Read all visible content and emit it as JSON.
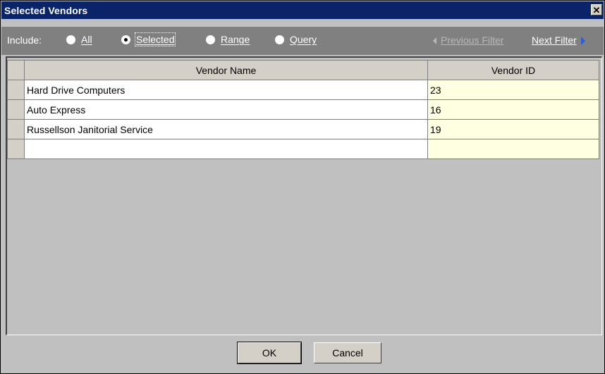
{
  "window": {
    "title": "Selected Vendors",
    "close_glyph": "✕"
  },
  "filter": {
    "include_label": "Include:",
    "options": [
      {
        "label": "All",
        "checked": false
      },
      {
        "label": "Selected",
        "checked": true
      },
      {
        "label": "Range",
        "checked": false
      },
      {
        "label": "Query",
        "checked": false
      }
    ],
    "previous_filter": "Previous Filter",
    "next_filter": "Next Filter"
  },
  "grid": {
    "columns": [
      "Vendor Name",
      "Vendor ID"
    ],
    "rows": [
      {
        "name": "Hard Drive Computers",
        "id": "23"
      },
      {
        "name": "Auto Express",
        "id": "16"
      },
      {
        "name": "Russellson Janitorial Service",
        "id": "19"
      },
      {
        "name": "",
        "id": ""
      }
    ]
  },
  "buttons": {
    "ok": "OK",
    "cancel": "Cancel"
  },
  "colors": {
    "title_bar": "#0a246a",
    "filter_bar": "#808080",
    "id_cell": "#ffffe1",
    "next_arrow": "#2b5fd9"
  }
}
